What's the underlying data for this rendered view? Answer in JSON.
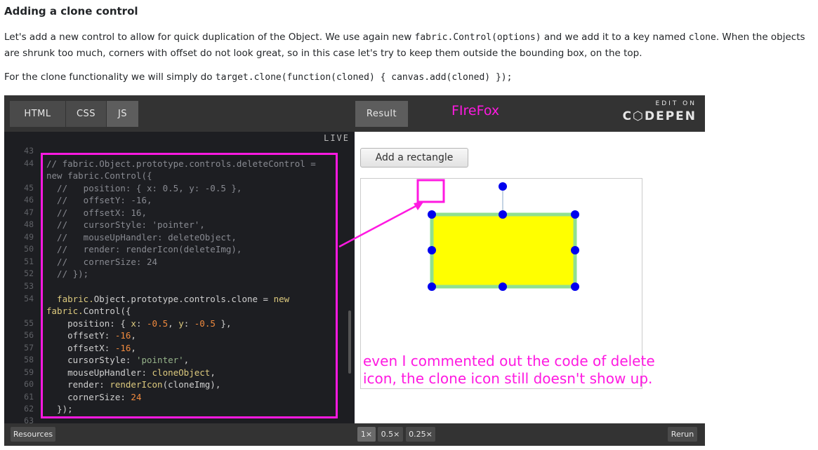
{
  "article": {
    "heading": "Adding a clone control",
    "p1": {
      "t1": "Let's add a new control to allow for quick duplication of the Object. We use again new ",
      "c1": "fabric.Control(options)",
      "t2": " and we add it to a key named ",
      "c2": "clone",
      "t3": ". When the objects are shrunk too much, corners with offset do not look great, so in this case let's try to keep them outside the bounding box, on the top."
    },
    "p2": {
      "t1": "For the clone functionality we will simply do ",
      "c1": "target.clone(function(cloned) { canvas.add(cloned) });"
    }
  },
  "embed": {
    "tabs": [
      "HTML",
      "CSS",
      "JS"
    ],
    "active_tab": "JS",
    "result_tab": "Result",
    "browser_label": "FIreFox",
    "edit_on": "EDIT ON",
    "brand": "C⬡DEPEN",
    "live": "LIVE",
    "code": {
      "ln43": "43",
      "ln44": "44",
      "l44a": "// fabric.Object.prototype.controls.deleteControl =",
      "l44b": "new fabric.Control({",
      "ln45": "45",
      "l45": "  //   position: { x: 0.5, y: -0.5 },",
      "ln46": "46",
      "l46": "  //   offsetY: -16,",
      "ln47": "47",
      "l47": "  //   offsetX: 16,",
      "ln48": "48",
      "l48": "  //   cursorStyle: 'pointer',",
      "ln49": "49",
      "l49": "  //   mouseUpHandler: deleteObject,",
      "ln50": "50",
      "l50": "  //   render: renderIcon(deleteImg),",
      "ln51": "51",
      "l51": "  //   cornerSize: 24",
      "ln52": "52",
      "l52": "  // });",
      "ln53": "53",
      "ln54": "54",
      "l54a1": "  fabric.",
      "l54a2": "Object",
      "l54a3": ".prototype.controls.clone = ",
      "l54a4": "new",
      "l54b1": "fabric.",
      "l54b2": "Control",
      "l54b3": "({",
      "ln55": "55",
      "l55a": "    position: { ",
      "l55b": "x",
      "l55c": ": ",
      "l55d": "-0.5",
      "l55e": ", ",
      "l55f": "y",
      "l55g": ": ",
      "l55h": "-0.5",
      "l55i": " },",
      "ln56": "56",
      "l56a": "    offsetY: ",
      "l56b": "-16",
      "l56c": ",",
      "ln57": "57",
      "l57a": "    offsetX: ",
      "l57b": "-16",
      "l57c": ",",
      "ln58": "58",
      "l58a": "    cursorStyle: ",
      "l58b": "'pointer'",
      "l58c": ",",
      "ln59": "59",
      "l59a": "    mouseUpHandler: ",
      "l59b": "cloneObject",
      "l59c": ",",
      "ln60": "60",
      "l60a": "    render: ",
      "l60b": "renderIcon",
      "l60c": "(cloneImg),",
      "ln61": "61",
      "l61a": "    cornerSize: ",
      "l61b": "24",
      "ln62": "62",
      "l62": "  });",
      "ln63": "63"
    },
    "add_button": "Add a rectangle",
    "bottom": {
      "resources": "Resources",
      "zoom": [
        "1×",
        "0.5×",
        "0.25×"
      ],
      "rerun": "Rerun"
    }
  },
  "annotation": "even I commented out the code of delete icon, the clone icon still doesn't show up.",
  "colors": {
    "annotation": "#ff19e1",
    "rect_fill": "#ffff00",
    "rect_border": "#90e090",
    "handles": "#0000ee"
  }
}
